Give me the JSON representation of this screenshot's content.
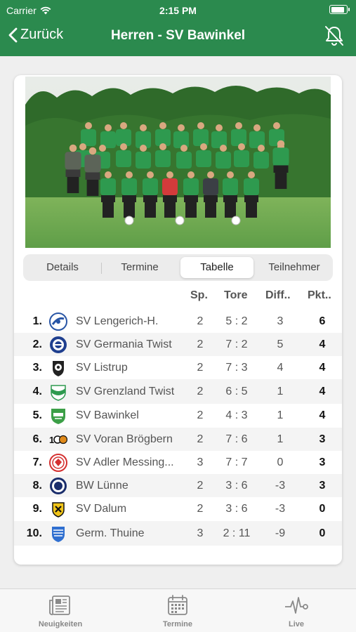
{
  "status_bar": {
    "carrier": "Carrier",
    "time": "2:15 PM",
    "battery_level": 0.9
  },
  "nav": {
    "back_label": "Zurück",
    "title": "Herren - SV Bawinkel"
  },
  "tabs": [
    {
      "label": "Details",
      "active": false
    },
    {
      "label": "Termine",
      "active": false
    },
    {
      "label": "Tabelle",
      "active": true
    },
    {
      "label": "Teilnehmer",
      "active": false
    }
  ],
  "table": {
    "columns": {
      "sp": "Sp.",
      "tore": "Tore",
      "diff": "Diff..",
      "pkt": "Pkt.."
    },
    "rows": [
      {
        "rank": "1.",
        "team": "SV Lengerich-H.",
        "sp": "2",
        "tore": "5 : 2",
        "diff": "3",
        "pkt": "6"
      },
      {
        "rank": "2.",
        "team": "SV Germania Twist",
        "sp": "2",
        "tore": "7 : 2",
        "diff": "5",
        "pkt": "4"
      },
      {
        "rank": "3.",
        "team": "SV Listrup",
        "sp": "2",
        "tore": "7 : 3",
        "diff": "4",
        "pkt": "4"
      },
      {
        "rank": "4.",
        "team": "SV Grenzland Twist",
        "sp": "2",
        "tore": "6 : 5",
        "diff": "1",
        "pkt": "4"
      },
      {
        "rank": "5.",
        "team": "SV Bawinkel",
        "sp": "2",
        "tore": "4 : 3",
        "diff": "1",
        "pkt": "4"
      },
      {
        "rank": "6.",
        "team": "SV Voran Brögbern",
        "sp": "2",
        "tore": "7 : 6",
        "diff": "1",
        "pkt": "3"
      },
      {
        "rank": "7.",
        "team": "SV Adler Messing...",
        "sp": "3",
        "tore": "7 : 7",
        "diff": "0",
        "pkt": "3"
      },
      {
        "rank": "8.",
        "team": "BW Lünne",
        "sp": "2",
        "tore": "3 : 6",
        "diff": "-3",
        "pkt": "3"
      },
      {
        "rank": "9.",
        "team": "SV Dalum",
        "sp": "2",
        "tore": "3 : 6",
        "diff": "-3",
        "pkt": "0"
      },
      {
        "rank": "10.",
        "team": "Germ. Thuine",
        "sp": "3",
        "tore": "2 : 11",
        "diff": "-9",
        "pkt": "0"
      }
    ]
  },
  "tabbar": [
    {
      "label": "Neuigkeiten",
      "icon": "newspaper-icon"
    },
    {
      "label": "Termine",
      "icon": "calendar-icon"
    },
    {
      "label": "Live",
      "icon": "pulse-icon"
    }
  ],
  "colors": {
    "brand": "#2b8a4e",
    "jersey": "#2e9a4f",
    "grass": "#5f9e48",
    "hedge": "#2f6a2a"
  }
}
